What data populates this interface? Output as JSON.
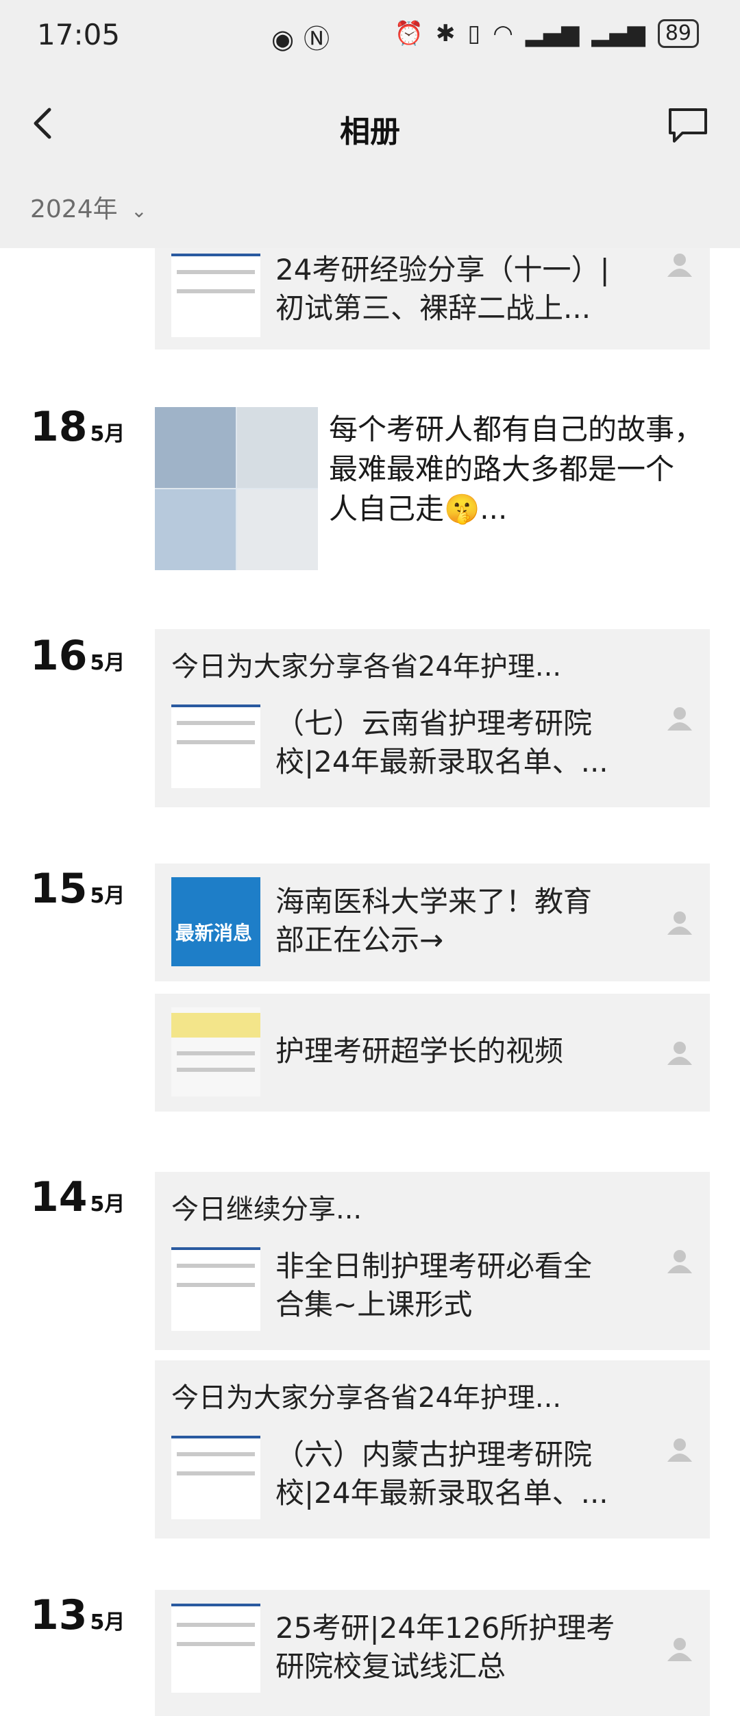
{
  "status_bar": {
    "time": "17:05",
    "battery": "89"
  },
  "header": {
    "title": "相册",
    "year_filter": "2024年"
  },
  "entries": [
    {
      "text_lines": [
        "24考研经验分享（十一）|",
        "初试第三、裸辞二战上..."
      ]
    },
    {
      "day": "18",
      "month": "5月",
      "text_lines": [
        "每个考研人都有自己的故事，",
        "最难最难的路大多都是一个",
        "人自己走🤫..."
      ]
    },
    {
      "day": "16",
      "month": "5月",
      "intro": "今日为大家分享各省24年护理...",
      "text_lines": [
        "（七）云南省护理考研院",
        "校|24年最新录取名单、..."
      ]
    },
    {
      "day": "15",
      "month": "5月",
      "text_lines": [
        "海南医科大学来了！教育",
        "部正在公示→"
      ],
      "thumb_label": "最新消息"
    },
    {
      "text_lines": [
        "护理考研超学长的视频"
      ]
    },
    {
      "day": "14",
      "month": "5月",
      "intro": "今日继续分享...",
      "text_lines": [
        "非全日制护理考研必看全",
        "合集~上课形式"
      ]
    },
    {
      "intro": "今日为大家分享各省24年护理...",
      "text_lines": [
        "（六）内蒙古护理考研院",
        "校|24年最新录取名单、..."
      ]
    },
    {
      "day": "13",
      "month": "5月",
      "text_lines": [
        "25考研|24年126所护理考",
        "研院校复试线汇总"
      ]
    }
  ]
}
